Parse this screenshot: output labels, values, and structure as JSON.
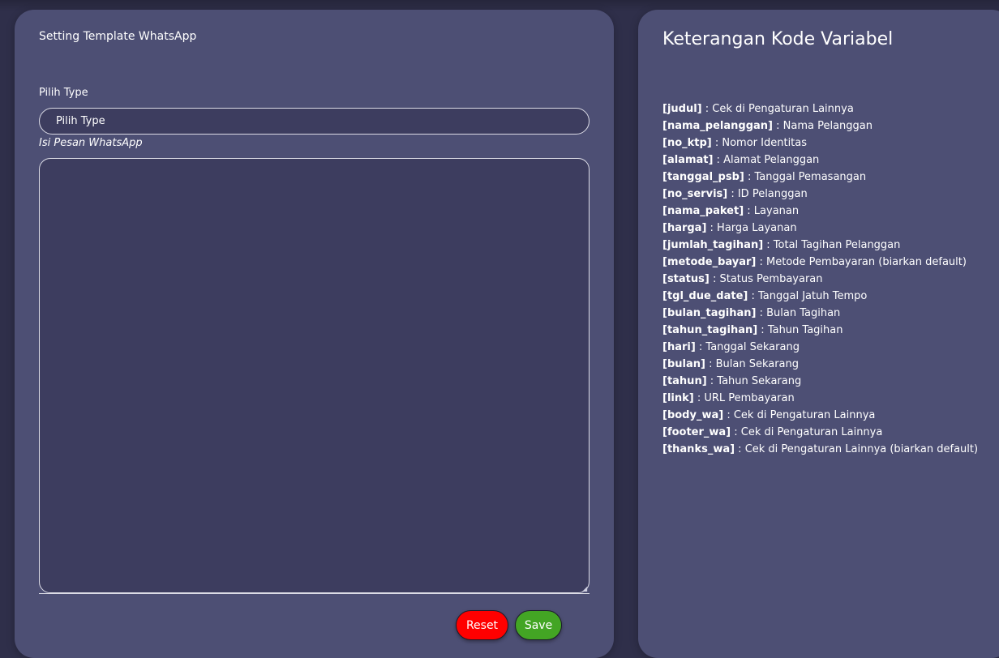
{
  "template_panel": {
    "title": "Setting Template WhatsApp",
    "type_label": "Pilih Type",
    "type_select_value": "Pilih Type",
    "message_label": "Isi Pesan WhatsApp",
    "message_value": "",
    "reset_label": "Reset",
    "save_label": "Save"
  },
  "variables_panel": {
    "title": "Keterangan Kode Variabel",
    "items": [
      {
        "code": "[judul]",
        "desc": " : Cek di Pengaturan Lainnya"
      },
      {
        "code": "[nama_pelanggan]",
        "desc": " : Nama Pelanggan"
      },
      {
        "code": "[no_ktp]",
        "desc": " : Nomor Identitas"
      },
      {
        "code": "[alamat]",
        "desc": " : Alamat Pelanggan"
      },
      {
        "code": "[tanggal_psb]",
        "desc": " : Tanggal Pemasangan"
      },
      {
        "code": "[no_servis]",
        "desc": " : ID Pelanggan"
      },
      {
        "code": "[nama_paket]",
        "desc": " : Layanan"
      },
      {
        "code": "[harga]",
        "desc": " : Harga Layanan"
      },
      {
        "code": "[jumlah_tagihan]",
        "desc": " : Total Tagihan Pelanggan"
      },
      {
        "code": "[metode_bayar]",
        "desc": " : Metode Pembayaran (biarkan default)"
      },
      {
        "code": "[status]",
        "desc": " : Status Pembayaran"
      },
      {
        "code": "[tgl_due_date]",
        "desc": " : Tanggal Jatuh Tempo"
      },
      {
        "code": "[bulan_tagihan]",
        "desc": " : Bulan Tagihan"
      },
      {
        "code": "[tahun_tagihan]",
        "desc": " : Tahun Tagihan"
      },
      {
        "code": "[hari]",
        "desc": " : Tanggal Sekarang"
      },
      {
        "code": "[bulan]",
        "desc": " : Bulan Sekarang"
      },
      {
        "code": "[tahun]",
        "desc": " : Tahun Sekarang"
      },
      {
        "code": "[link]",
        "desc": " : URL Pembayaran"
      },
      {
        "code": "[body_wa]",
        "desc": " : Cek di Pengaturan Lainnya"
      },
      {
        "code": "[footer_wa]",
        "desc": " : Cek di Pengaturan Lainnya"
      },
      {
        "code": "[thanks_wa]",
        "desc": " : Cek di Pengaturan Lainnya (biarkan default)"
      }
    ]
  },
  "colors": {
    "page_background": "#2f2f4a",
    "card_background": "#4d4f74",
    "input_background": "#3d3d5f",
    "reset_button": "#ff0000",
    "save_button": "#43a524"
  }
}
